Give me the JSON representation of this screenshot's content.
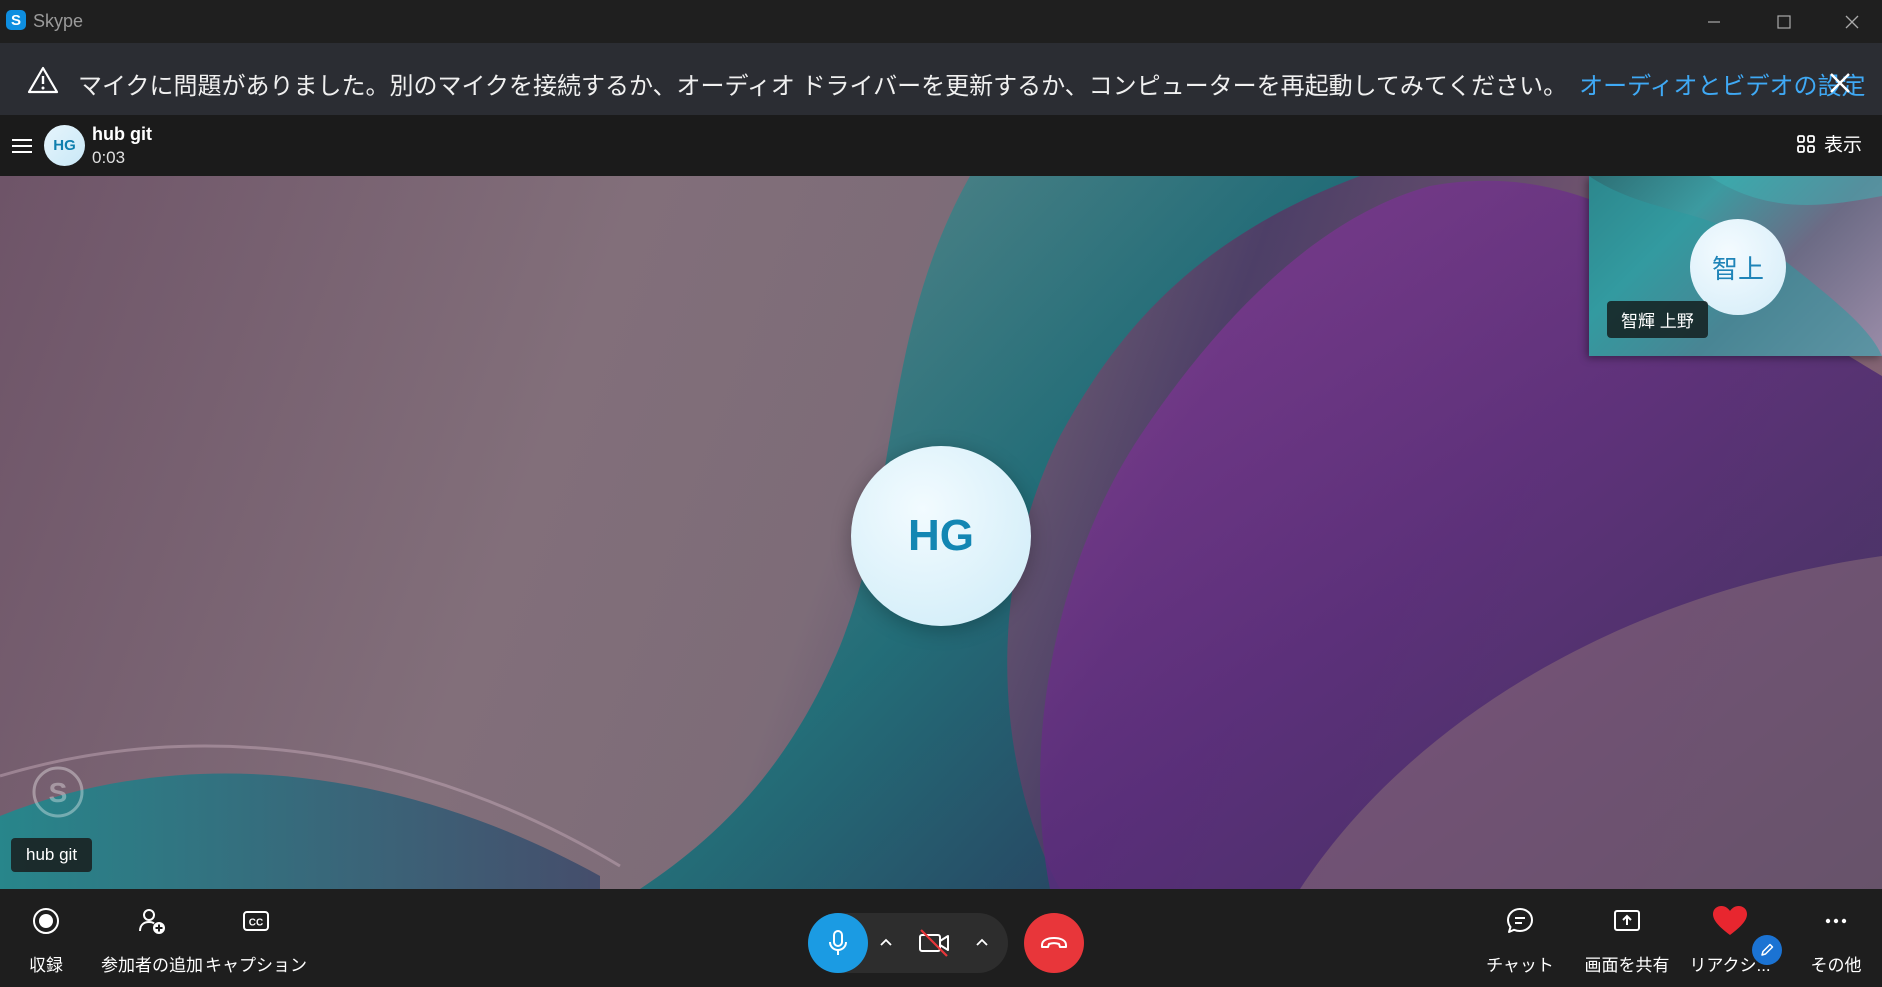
{
  "window": {
    "title": "Skype",
    "logo_letter": "S"
  },
  "notification": {
    "message": "マイクに問題がありました。別のマイクを接続するか、オーディオ ドライバーを更新するか、コンピューターを再起動してみてください。",
    "link": "オーディオとビデオの設定"
  },
  "header": {
    "avatar_initials": "HG",
    "name": "hub git",
    "duration": "0:03",
    "view_label": "表示"
  },
  "stage": {
    "remote_initials": "HG",
    "remote_name": "hub git",
    "self_initials": "智上",
    "self_name": "智輝 上野"
  },
  "toolbar": {
    "record": "収録",
    "add_participant": "参加者の追加",
    "captions": "キャプション",
    "chat": "チャット",
    "share_screen": "画面を共有",
    "reactions": "リアクシ...",
    "more": "その他"
  },
  "colors": {
    "accent": "#1b9be3",
    "link": "#3fa9f5",
    "hangup": "#e8363a",
    "reaction_heart": "#e8262f"
  }
}
